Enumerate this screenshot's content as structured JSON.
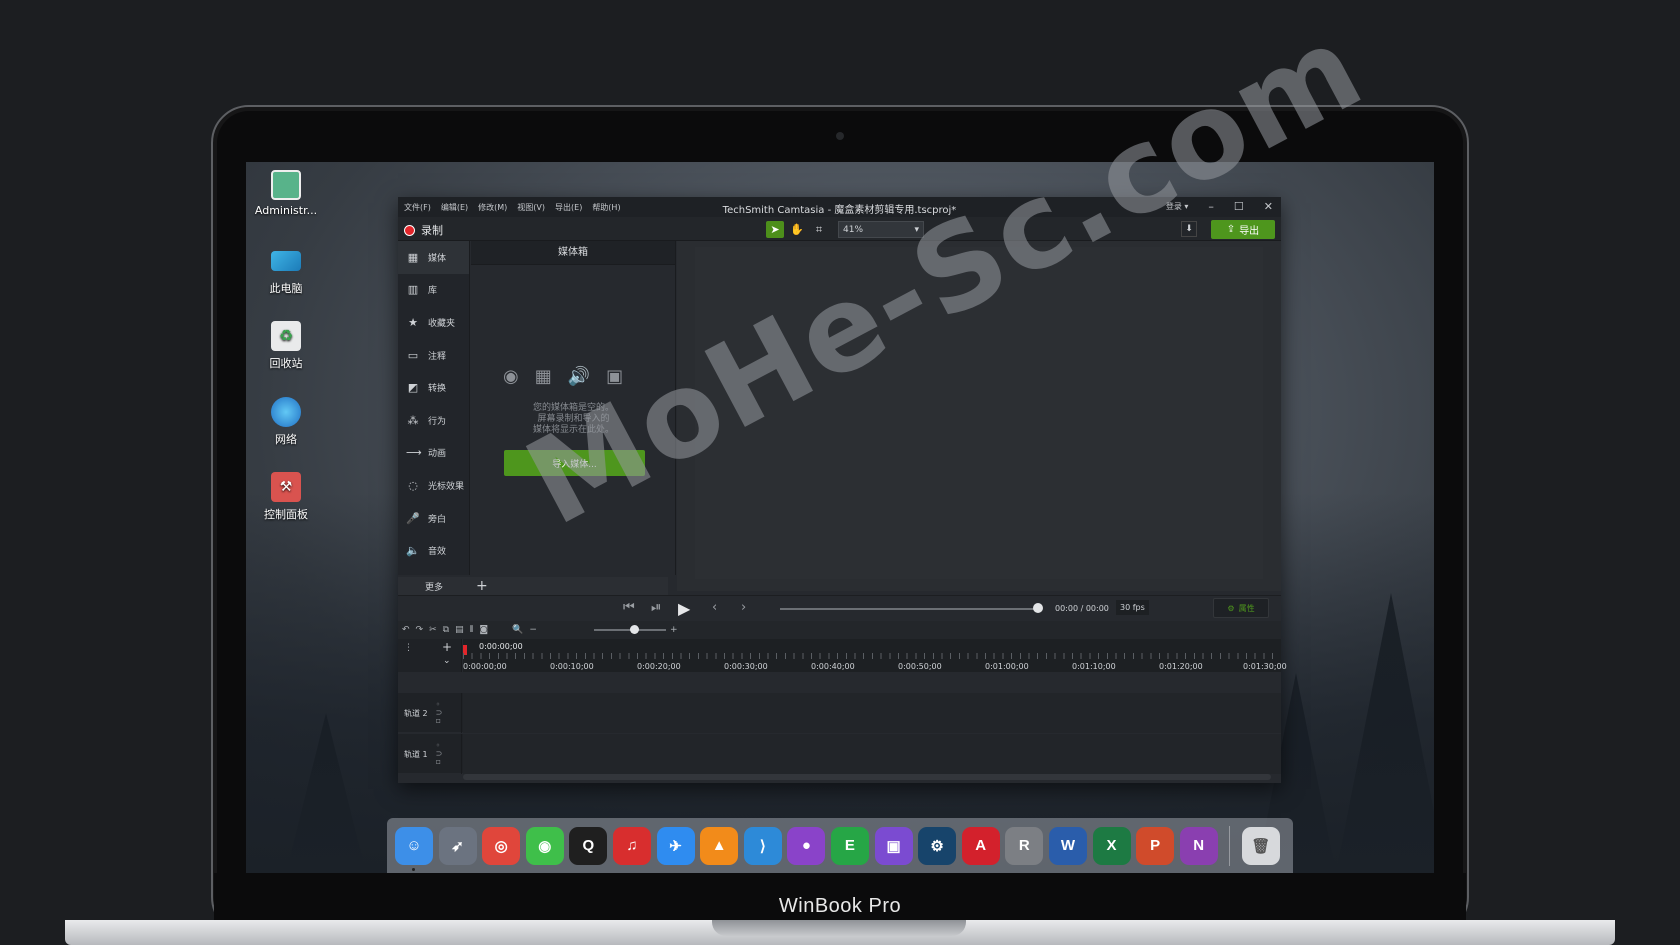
{
  "device": {
    "brand": "WinBook Pro"
  },
  "desktop": {
    "icons": [
      {
        "label": "Administr...",
        "icon": "user-folder-icon"
      },
      {
        "label": "此电脑",
        "icon": "computer-icon"
      },
      {
        "label": "回收站",
        "icon": "recycle-bin-icon"
      },
      {
        "label": "网络",
        "icon": "network-globe-icon"
      },
      {
        "label": "控制面板",
        "icon": "control-panel-icon"
      }
    ]
  },
  "app": {
    "title": "TechSmith Camtasia - 魔盒素材剪辑专用.tscproj*",
    "menu": [
      "文件(F)",
      "编辑(E)",
      "修改(M)",
      "视图(V)",
      "导出(E)",
      "帮助(H)"
    ],
    "login": "登录",
    "record_label": "录制",
    "zoom_value": "41%",
    "export_label": "导出",
    "sidebar": [
      {
        "label": "媒体",
        "icon": "film-icon"
      },
      {
        "label": "库",
        "icon": "library-icon"
      },
      {
        "label": "收藏夹",
        "icon": "star-icon"
      },
      {
        "label": "注释",
        "icon": "annotation-icon"
      },
      {
        "label": "转换",
        "icon": "transition-icon"
      },
      {
        "label": "行为",
        "icon": "behavior-icon"
      },
      {
        "label": "动画",
        "icon": "animation-icon"
      },
      {
        "label": "光标效果",
        "icon": "cursor-effect-icon"
      },
      {
        "label": "旁白",
        "icon": "microphone-icon"
      },
      {
        "label": "音效",
        "icon": "speaker-icon"
      }
    ],
    "more_label": "更多",
    "media_bin": {
      "title": "媒体箱",
      "empty_lines": [
        "您的媒体箱是空的。",
        "屏幕录制和导入的",
        "媒体将显示在此处。"
      ],
      "import_label": "导入媒体..."
    },
    "playback": {
      "time": "00:00 / 00:00",
      "fps": "30 fps",
      "properties_label": "属性"
    },
    "timeline": {
      "playhead_time": "0:00:00;00",
      "ticks": [
        "0:00:00;00",
        "0:00:10;00",
        "0:00:20;00",
        "0:00:30;00",
        "0:00:40;00",
        "0:00:50;00",
        "0:01:00;00",
        "0:01:10;00",
        "0:01:20;00",
        "0:01:30;00"
      ],
      "tracks": [
        "轨道 2",
        "轨道 1"
      ]
    }
  },
  "watermark": "MoHe-Sc.com",
  "dock": [
    {
      "name": "finder",
      "glyph": "☺",
      "color": "#3d8fe8"
    },
    {
      "name": "launchpad",
      "glyph": "➶",
      "color": "#6b7380"
    },
    {
      "name": "chrome",
      "glyph": "◎",
      "color": "#e0463b"
    },
    {
      "name": "wechat",
      "glyph": "◉",
      "color": "#3fbf4a"
    },
    {
      "name": "qq",
      "glyph": "Q",
      "color": "#1f1f1f"
    },
    {
      "name": "netease-music",
      "glyph": "♫",
      "color": "#d82e2e"
    },
    {
      "name": "feishu",
      "glyph": "✈",
      "color": "#2f8cf0"
    },
    {
      "name": "vlc",
      "glyph": "▲",
      "color": "#f28b1a"
    },
    {
      "name": "vscode",
      "glyph": "⟩",
      "color": "#2d8ad8"
    },
    {
      "name": "github",
      "glyph": "●",
      "color": "#8a43c9"
    },
    {
      "name": "evernote",
      "glyph": "E",
      "color": "#26a646"
    },
    {
      "name": "twitch",
      "glyph": "▣",
      "color": "#7b4bd1"
    },
    {
      "name": "steam",
      "glyph": "⚙",
      "color": "#17446b"
    },
    {
      "name": "acrobat",
      "glyph": "A",
      "color": "#d3212c"
    },
    {
      "name": "rhino",
      "glyph": "R",
      "color": "#7c7f84"
    },
    {
      "name": "word",
      "glyph": "W",
      "color": "#2a5dab"
    },
    {
      "name": "excel",
      "glyph": "X",
      "color": "#1d7a43"
    },
    {
      "name": "powerpoint",
      "glyph": "P",
      "color": "#d04b2b"
    },
    {
      "name": "onenote",
      "glyph": "N",
      "color": "#8a3fb0"
    },
    {
      "name": "trash",
      "glyph": "🗑",
      "color": "#d7d9dc"
    }
  ]
}
